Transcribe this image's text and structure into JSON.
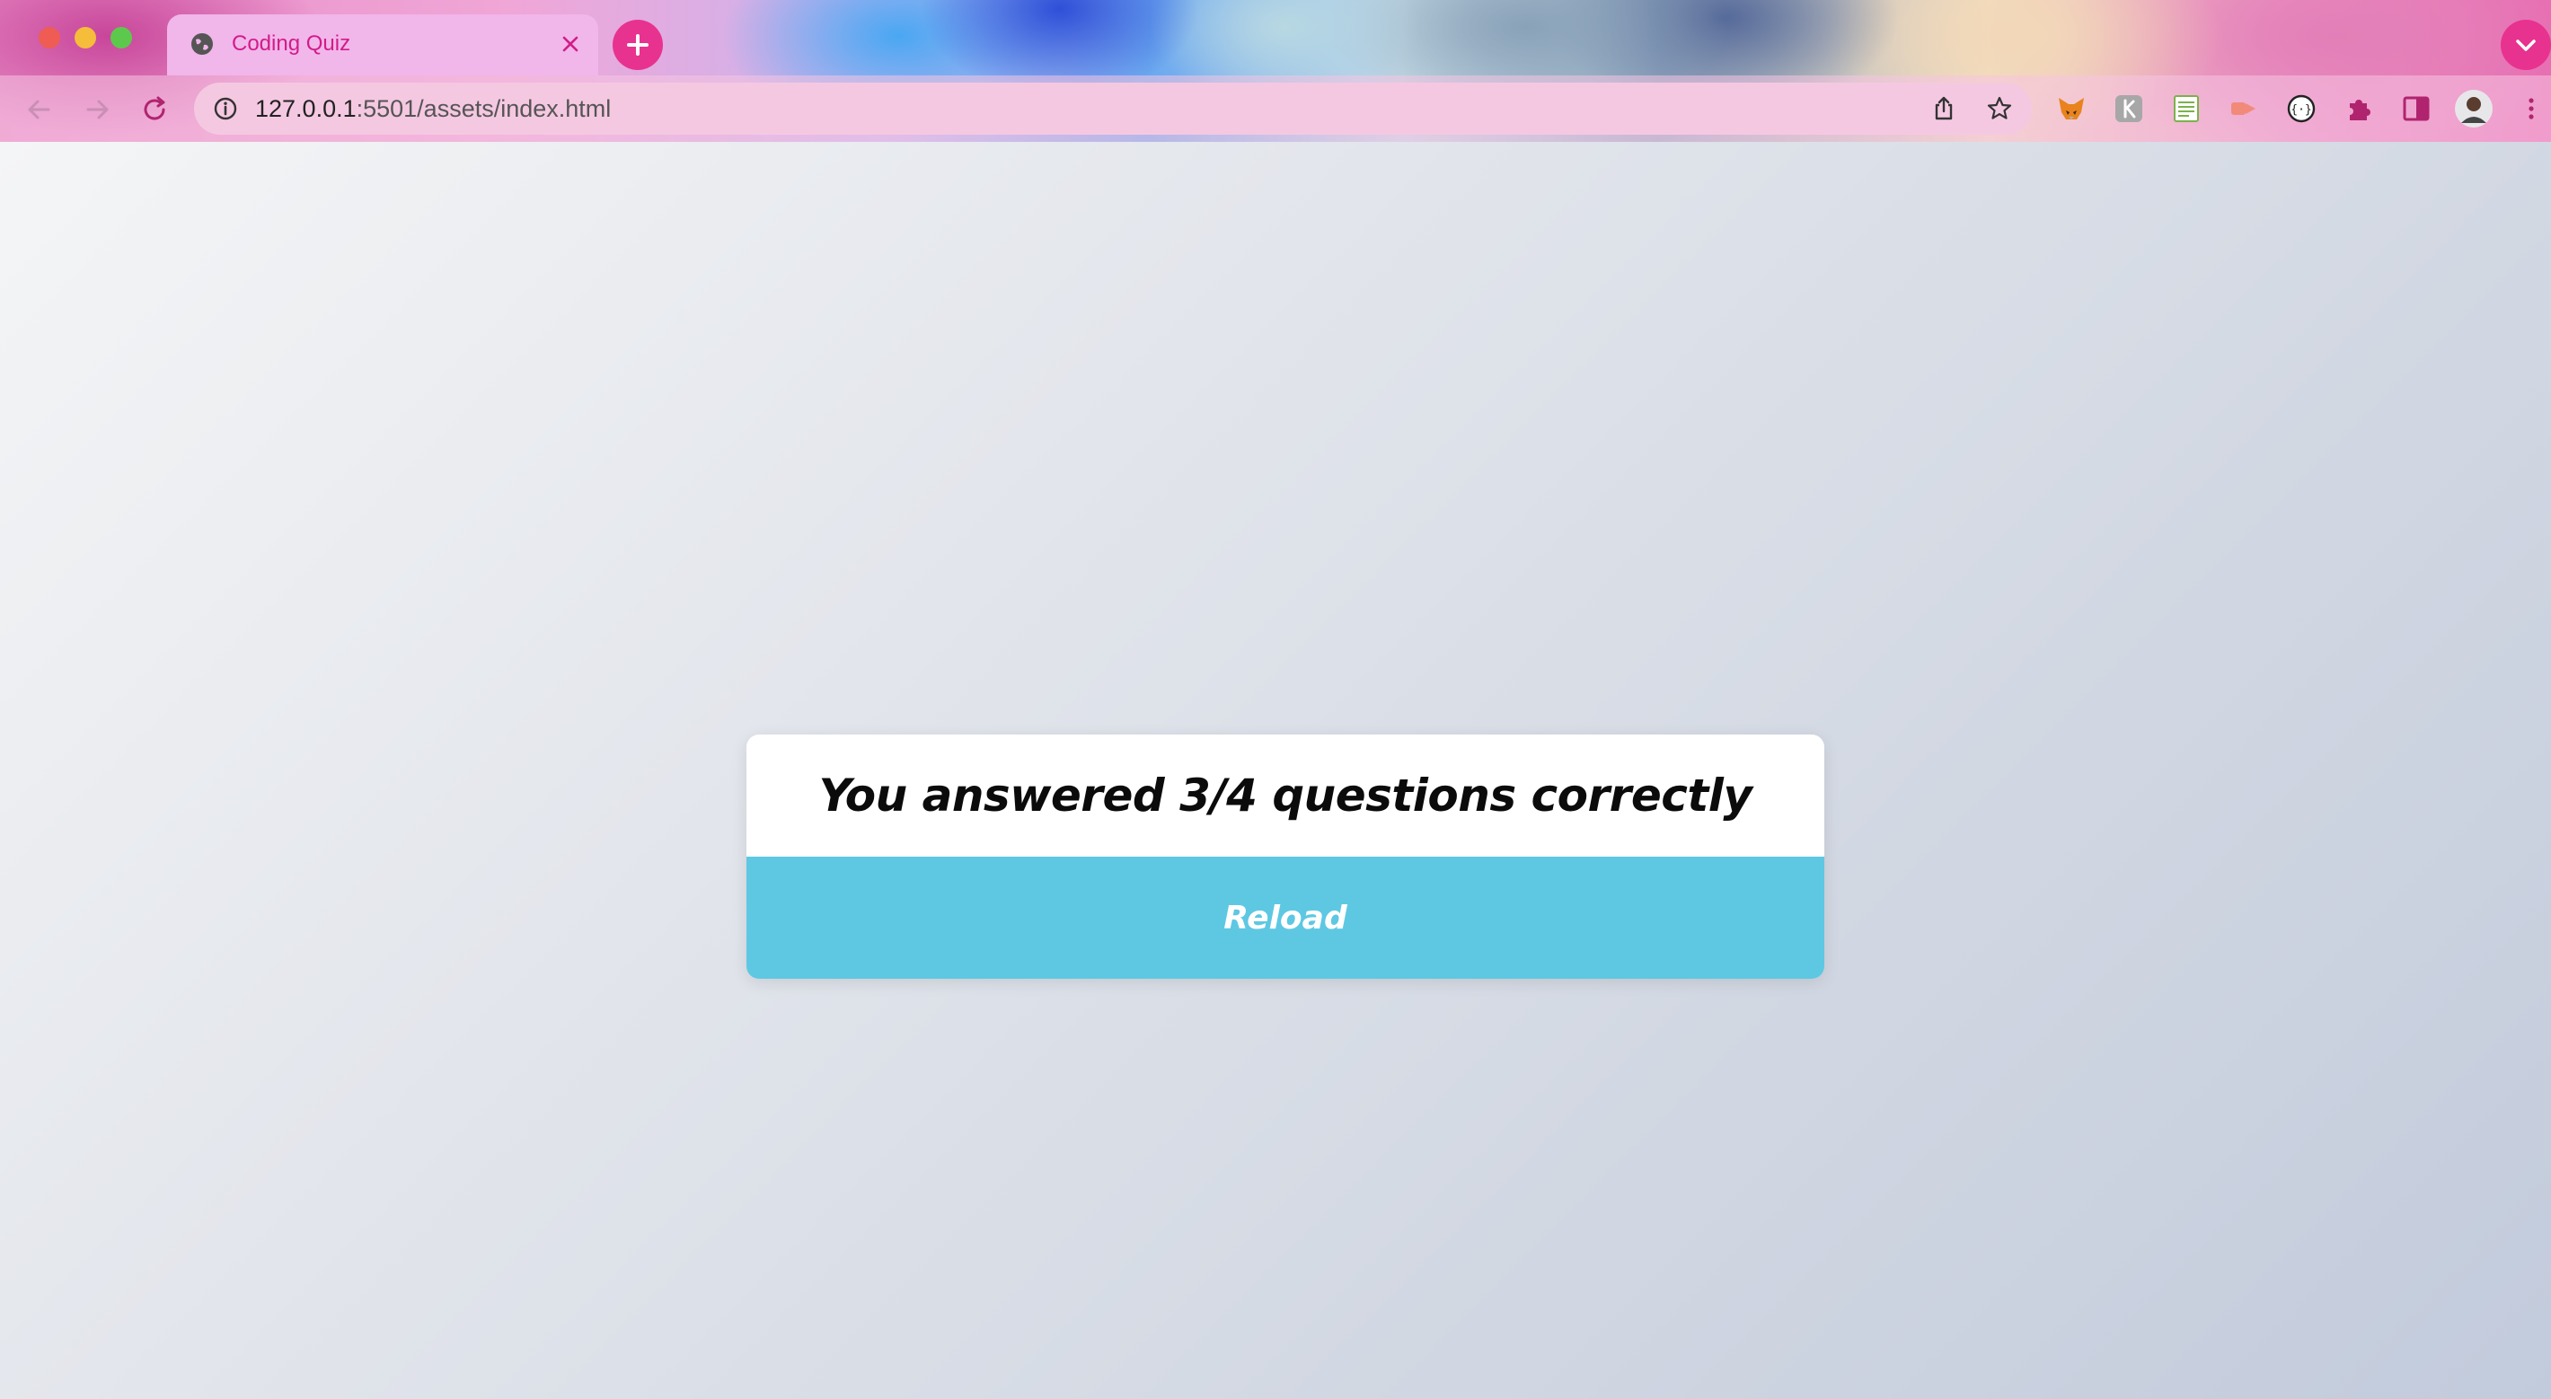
{
  "browser": {
    "tab": {
      "title": "Coding Quiz"
    },
    "address_bar": {
      "host": "127.0.0.1",
      "path": ":5501/assets/index.html"
    },
    "colors": {
      "accent": "#e8328f",
      "tab_text": "#d21c8a"
    },
    "extension_icons": [
      "metamask-fox-icon",
      "k-extension-icon",
      "sheet-extension-icon",
      "red-arrow-extension-icon",
      "braces-extension-icon",
      "puzzle-extensions-icon",
      "side-panel-icon",
      "profile-avatar",
      "more-menu-icon"
    ]
  },
  "quiz": {
    "result_message": "You answered 3/4 questions correctly",
    "correct": 3,
    "total": 4,
    "reload_label": "Reload",
    "colors": {
      "button": "#5ec8e3",
      "card": "#ffffff"
    }
  }
}
